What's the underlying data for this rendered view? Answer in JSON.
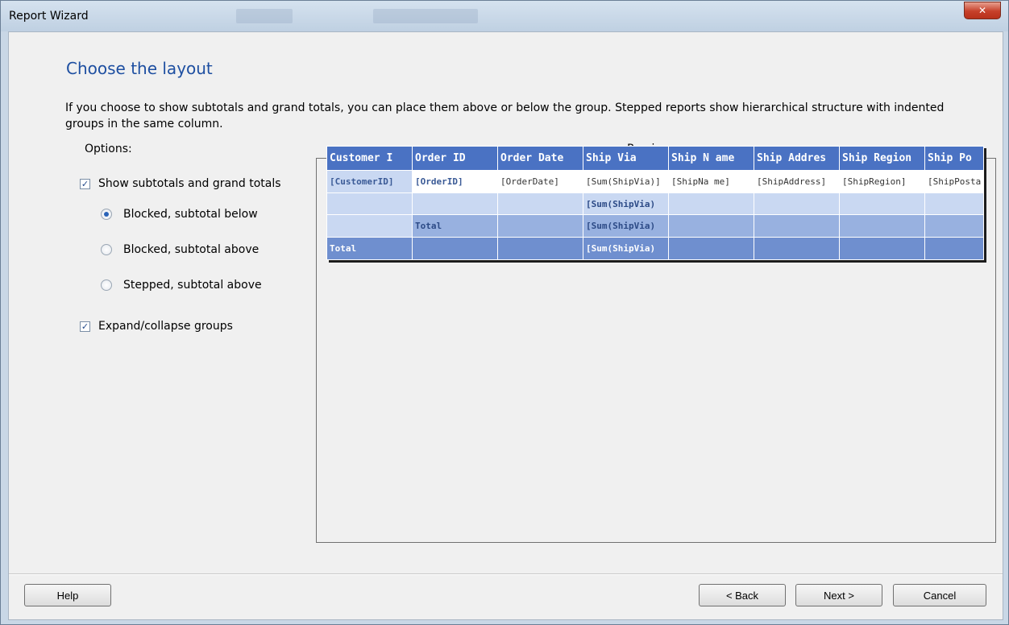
{
  "window": {
    "title": "Report Wizard",
    "close_glyph": "✕"
  },
  "page": {
    "heading": "Choose the layout",
    "description": "If you choose to show subtotals and grand totals, you can place them above or below the group. Stepped reports show hierarchical structure with indented groups in the same column.",
    "options_label": "Options:",
    "preview_label": "Preview"
  },
  "options": {
    "show_totals": {
      "label": "Show subtotals and grand totals",
      "checked": true
    },
    "layouts": [
      {
        "label": "Blocked, subtotal below",
        "selected": true
      },
      {
        "label": "Blocked, subtotal above",
        "selected": false
      },
      {
        "label": "Stepped, subtotal above",
        "selected": false
      }
    ],
    "expand_collapse": {
      "label": "Expand/collapse groups",
      "checked": true
    }
  },
  "preview": {
    "headers": [
      "Customer I",
      "Order ID",
      "Order Date",
      "Ship Via",
      "Ship N ame",
      "Ship Addres",
      "Ship Region",
      "Ship Po"
    ],
    "row1": [
      "[CustomerID]",
      "[OrderID]",
      "[OrderDate]",
      "[Sum(ShipVia)]",
      "[ShipNa me]",
      "[ShipAddress]",
      "[ShipRegion]",
      "[ShipPosta"
    ],
    "row2_sum": "[Sum(ShipVia)",
    "row3_label": "Total",
    "row3_sum": "[Sum(ShipVia)",
    "row4_label": "Total",
    "row4_sum": "[Sum(ShipVia)"
  },
  "buttons": {
    "help": "Help",
    "back": "< Back",
    "next": "Next >",
    "cancel": "Cancel"
  },
  "colors": {
    "heading": "#1e4fa1",
    "header_fill": "#4a72c3",
    "close_button": "#c6402a"
  }
}
